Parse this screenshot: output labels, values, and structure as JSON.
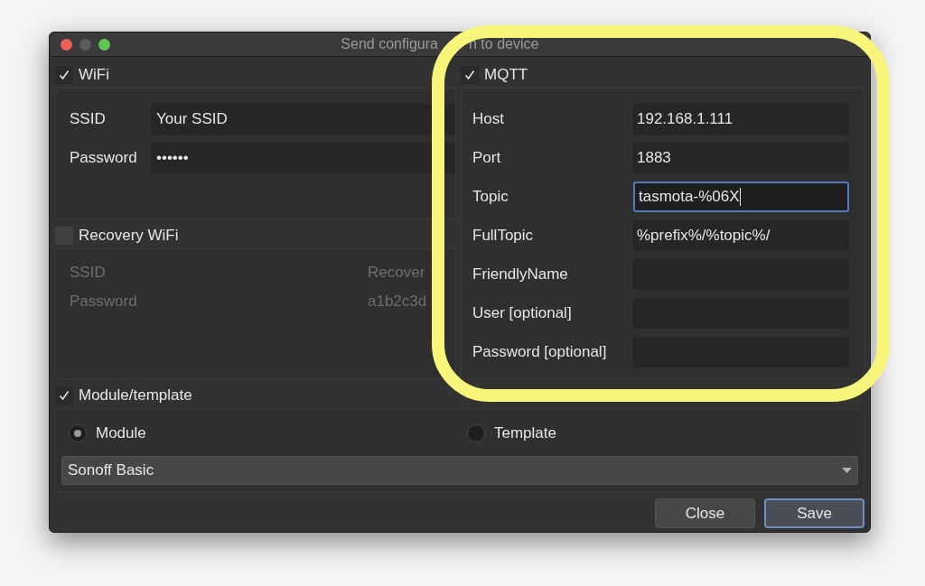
{
  "window": {
    "title_parts": [
      "Send configura",
      "n to device"
    ]
  },
  "wifi": {
    "label": "WiFi",
    "checked": true,
    "fields": [
      {
        "label": "SSID",
        "value": "Your SSID"
      },
      {
        "label": "Password",
        "value": "••••••"
      }
    ]
  },
  "recovery_wifi": {
    "label": "Recovery WiFi",
    "checked": false,
    "fields": [
      {
        "label": "SSID",
        "value": "Recover"
      },
      {
        "label": "Password",
        "value": "a1b2c3d"
      }
    ]
  },
  "mqtt": {
    "label": "MQTT",
    "checked": true,
    "fields": [
      {
        "label": "Host",
        "value": "192.168.1.111",
        "focused": false
      },
      {
        "label": "Port",
        "value": "1883",
        "focused": false
      },
      {
        "label": "Topic",
        "value": "tasmota-%06X",
        "focused": true
      },
      {
        "label": "FullTopic",
        "value": "%prefix%/%topic%/",
        "focused": false
      },
      {
        "label": "FriendlyName",
        "focused": false
      },
      {
        "label": "User [optional]",
        "focused": false
      },
      {
        "label": "Password [optional]",
        "focused": false
      }
    ]
  },
  "module_template": {
    "label": "Module/template",
    "checked": true,
    "options": [
      {
        "label": "Module",
        "selected": true
      },
      {
        "label": "Template",
        "selected": false
      }
    ],
    "dropdown": {
      "value": "Sonoff Basic"
    }
  },
  "buttons": [
    {
      "label": "Close",
      "default": false
    },
    {
      "label": "Save",
      "default": true
    }
  ]
}
